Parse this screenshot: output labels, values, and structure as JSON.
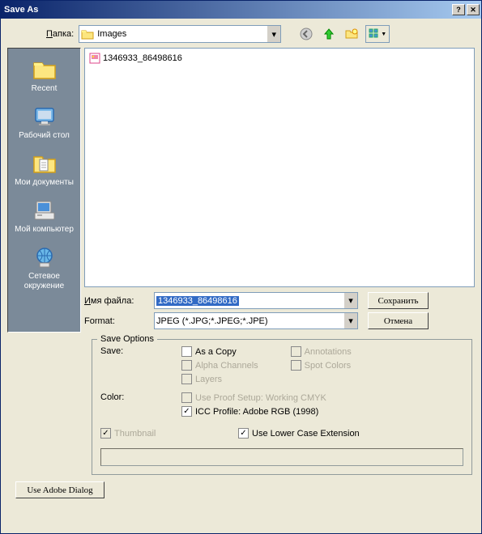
{
  "title": "Save As",
  "lookin_label": "Папка:",
  "lookin_value": "Images",
  "files": [
    {
      "name": "1346933_86498616"
    }
  ],
  "sidebar": [
    {
      "id": "recent",
      "label": "Recent"
    },
    {
      "id": "desktop",
      "label": "Рабочий стол"
    },
    {
      "id": "mydocs",
      "label": "Мои документы"
    },
    {
      "id": "mycomp",
      "label": "Мой компьютер"
    },
    {
      "id": "network",
      "label": "Сетевое окружение"
    }
  ],
  "filename_label": "Имя файла:",
  "filename_value": "1346933_86498616",
  "format_label": "Format:",
  "format_value": "JPEG (*.JPG;*.JPEG;*.JPE)",
  "save_btn": "Сохранить",
  "cancel_btn": "Отмена",
  "options": {
    "legend": "Save Options",
    "save_label": "Save:",
    "as_copy": "As a Copy",
    "alpha": "Alpha Channels",
    "layers": "Layers",
    "annotations": "Annotations",
    "spot": "Spot Colors",
    "color_label": "Color:",
    "proof": "Use Proof Setup:  Working CMYK",
    "icc": "ICC Profile:  Adobe RGB (1998)",
    "thumbnail": "Thumbnail",
    "lowercase": "Use Lower Case Extension"
  },
  "adobe_btn": "Use Adobe Dialog"
}
